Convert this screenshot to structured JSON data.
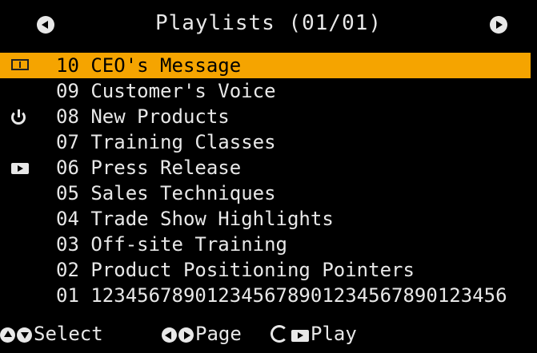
{
  "header": {
    "title": "Playlists (01/01)",
    "prev_icon": "circle-left-arrow-icon",
    "next_icon": "circle-right-arrow-icon"
  },
  "playlists": [
    {
      "label": "10 CEO's Message",
      "selected": true,
      "icon": "film-icon"
    },
    {
      "label": "09 Customer's Voice",
      "selected": false,
      "icon": ""
    },
    {
      "label": "08 New Products",
      "selected": false,
      "icon": "power-icon"
    },
    {
      "label": "07 Training Classes",
      "selected": false,
      "icon": ""
    },
    {
      "label": "06 Press Release",
      "selected": false,
      "icon": "play-rect-icon"
    },
    {
      "label": "05 Sales Techniques",
      "selected": false,
      "icon": ""
    },
    {
      "label": "04 Trade Show Highlights",
      "selected": false,
      "icon": ""
    },
    {
      "label": "03 Off-site Training",
      "selected": false,
      "icon": ""
    },
    {
      "label": "02 Product Positioning Pointers",
      "selected": false,
      "icon": ""
    },
    {
      "label": "01 123456789012345678901234567890123456",
      "selected": false,
      "icon": ""
    }
  ],
  "footer": {
    "select_label": "Select",
    "page_label": "Page",
    "play_label": "Play"
  },
  "colors": {
    "background": "#000000",
    "highlight": "#f5a400",
    "text": "#e8e8e8"
  }
}
